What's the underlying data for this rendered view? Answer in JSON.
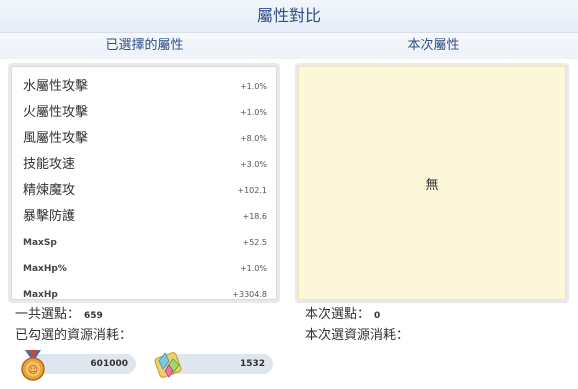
{
  "window": {
    "title": "屬性對比"
  },
  "headers": {
    "selected": "已選擇的屬性",
    "current": "本次屬性"
  },
  "attributes": [
    {
      "name": "水屬性攻擊",
      "value": "+1.0%"
    },
    {
      "name": "火屬性攻擊",
      "value": "+1.0%"
    },
    {
      "name": "風屬性攻擊",
      "value": "+8.0%"
    },
    {
      "name": "技能攻速",
      "value": "+3.0%"
    },
    {
      "name": "精煉魔攻",
      "value": "+102.1"
    },
    {
      "name": "暴擊防護",
      "value": "+18.6"
    },
    {
      "name": "MaxSp",
      "value": "+52.5"
    },
    {
      "name": "MaxHp%",
      "value": "+1.0%"
    },
    {
      "name": "MaxHp",
      "value": "+3304.8"
    }
  ],
  "current": {
    "value": "無"
  },
  "totals": {
    "total_points_label": "一共選點：",
    "total_points_value": "659",
    "consumed_label": "已勾選的資源消耗：",
    "current_points_label": "本次選點：",
    "current_points_value": "0",
    "current_consumed_label": "本次選資源消耗："
  },
  "resources": [
    {
      "icon": "medal-icon",
      "value": "601000"
    },
    {
      "icon": "crystal-bundle-icon",
      "value": "1532"
    }
  ]
}
